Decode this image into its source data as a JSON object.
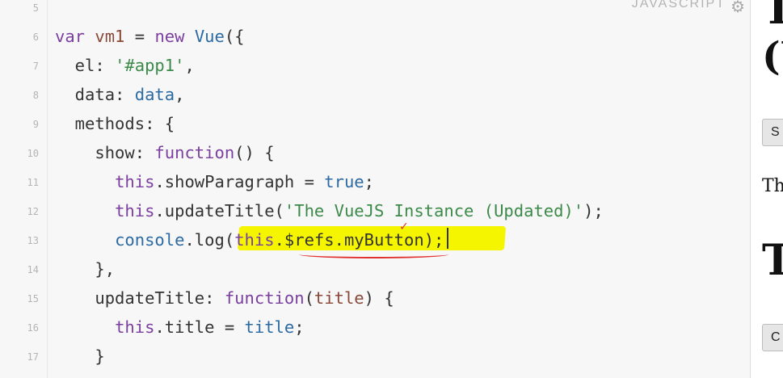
{
  "editor": {
    "language_label": "JAVASCRIPT",
    "settings_icon": "gear-icon",
    "line_numbers": [
      "5",
      "6",
      "7",
      "8",
      "9",
      "10",
      "11",
      "12",
      "13",
      "14",
      "15",
      "16",
      "17"
    ],
    "lines": [
      {
        "parts": []
      },
      {
        "parts": [
          {
            "t": "var ",
            "c": "kw"
          },
          {
            "t": "vm1",
            "c": "var"
          },
          {
            "t": " = ",
            "c": "prop"
          },
          {
            "t": "new ",
            "c": "kw"
          },
          {
            "t": "Vue",
            "c": "fn"
          },
          {
            "t": "({",
            "c": "prop"
          }
        ]
      },
      {
        "parts": [
          {
            "t": "  el: ",
            "c": "prop"
          },
          {
            "t": "'#app1'",
            "c": "str"
          },
          {
            "t": ",",
            "c": "prop"
          }
        ]
      },
      {
        "parts": [
          {
            "t": "  data: ",
            "c": "prop"
          },
          {
            "t": "data",
            "c": "fn"
          },
          {
            "t": ",",
            "c": "prop"
          }
        ]
      },
      {
        "parts": [
          {
            "t": "  methods: {",
            "c": "prop"
          }
        ]
      },
      {
        "parts": [
          {
            "t": "    show: ",
            "c": "prop"
          },
          {
            "t": "function",
            "c": "kw"
          },
          {
            "t": "() {",
            "c": "prop"
          }
        ]
      },
      {
        "parts": [
          {
            "t": "      ",
            "c": "prop"
          },
          {
            "t": "this",
            "c": "kw"
          },
          {
            "t": ".showParagraph = ",
            "c": "prop"
          },
          {
            "t": "true",
            "c": "fn"
          },
          {
            "t": ";",
            "c": "prop"
          }
        ]
      },
      {
        "parts": [
          {
            "t": "      ",
            "c": "prop"
          },
          {
            "t": "this",
            "c": "kw"
          },
          {
            "t": ".updateTitle(",
            "c": "prop"
          },
          {
            "t": "'The VueJS Instance (Updated)'",
            "c": "str"
          },
          {
            "t": ");",
            "c": "prop"
          }
        ]
      },
      {
        "parts": [
          {
            "t": "      ",
            "c": "prop"
          },
          {
            "t": "console",
            "c": "fn"
          },
          {
            "t": ".log(",
            "c": "prop"
          },
          {
            "t": "this",
            "c": "kw"
          },
          {
            "t": ".$refs.myButton);",
            "c": "prop"
          }
        ]
      },
      {
        "parts": [
          {
            "t": "    },",
            "c": "prop"
          }
        ]
      },
      {
        "parts": [
          {
            "t": "    updateTitle: ",
            "c": "prop"
          },
          {
            "t": "function",
            "c": "kw"
          },
          {
            "t": "(",
            "c": "prop"
          },
          {
            "t": "title",
            "c": "var"
          },
          {
            "t": ") {",
            "c": "prop"
          }
        ]
      },
      {
        "parts": [
          {
            "t": "      ",
            "c": "prop"
          },
          {
            "t": "this",
            "c": "kw"
          },
          {
            "t": ".title = ",
            "c": "prop"
          },
          {
            "t": "title",
            "c": "fn"
          },
          {
            "t": ";",
            "c": "prop"
          }
        ]
      },
      {
        "parts": [
          {
            "t": "    }",
            "c": "prop"
          }
        ]
      }
    ]
  },
  "preview": {
    "heading_partial_1": "T",
    "heading_partial_2": "(U",
    "button_1": "S",
    "text_1": "Th",
    "heading_partial_3": "T",
    "button_2": "C"
  },
  "colors": {
    "highlight": "#f5f500",
    "annotation_red": "#e03030"
  }
}
